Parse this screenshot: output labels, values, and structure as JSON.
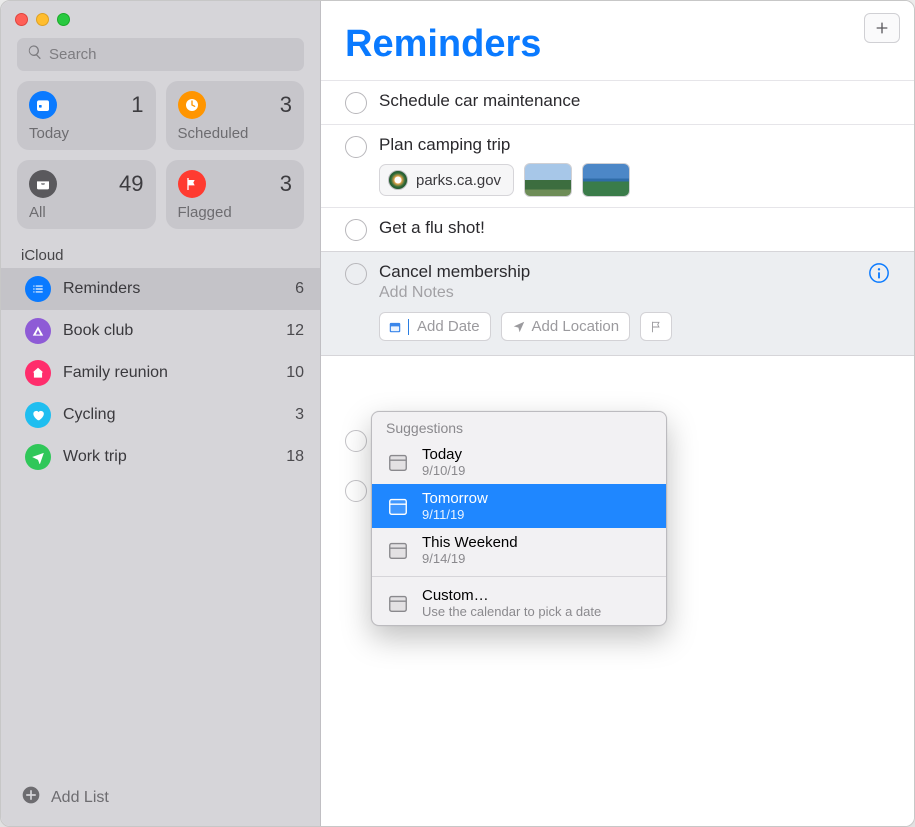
{
  "search": {
    "placeholder": "Search"
  },
  "smart_cards": [
    {
      "label": "Today",
      "count": 1,
      "icon": "calendar-day",
      "bg": "#0a7aff"
    },
    {
      "label": "Scheduled",
      "count": 3,
      "icon": "clock",
      "bg": "#ff9500"
    },
    {
      "label": "All",
      "count": 49,
      "icon": "tray",
      "bg": "#5a595d"
    },
    {
      "label": "Flagged",
      "count": 3,
      "icon": "flag",
      "bg": "#ff3b30"
    }
  ],
  "account_label": "iCloud",
  "lists": [
    {
      "name": "Reminders",
      "count": 6,
      "color": "#0a7aff",
      "icon": "list",
      "selected": true
    },
    {
      "name": "Book club",
      "count": 12,
      "color": "#8e5bd6",
      "icon": "tent",
      "selected": false
    },
    {
      "name": "Family reunion",
      "count": 10,
      "color": "#ff2d6c",
      "icon": "house",
      "selected": false
    },
    {
      "name": "Cycling",
      "count": 3,
      "color": "#1fbef0",
      "icon": "heart",
      "selected": false
    },
    {
      "name": "Work trip",
      "count": 18,
      "color": "#30c759",
      "icon": "plane",
      "selected": false
    }
  ],
  "add_list_label": "Add List",
  "main": {
    "title": "Reminders",
    "items": [
      {
        "title": "Schedule car maintenance"
      },
      {
        "title": "Plan camping trip",
        "link": "parks.ca.gov",
        "images": 2
      },
      {
        "title": "Get a flu shot!"
      },
      {
        "title": "Cancel membership",
        "editing": true,
        "notes_placeholder": "Add Notes",
        "chips": {
          "date": "Add Date",
          "location": "Add Location"
        }
      }
    ]
  },
  "popover": {
    "header": "Suggestions",
    "options": [
      {
        "title": "Today",
        "sub": "9/10/19",
        "selected": false
      },
      {
        "title": "Tomorrow",
        "sub": "9/11/19",
        "selected": true
      },
      {
        "title": "This Weekend",
        "sub": "9/14/19",
        "selected": false
      }
    ],
    "custom": {
      "title": "Custom…",
      "sub": "Use the calendar to pick a date"
    }
  }
}
